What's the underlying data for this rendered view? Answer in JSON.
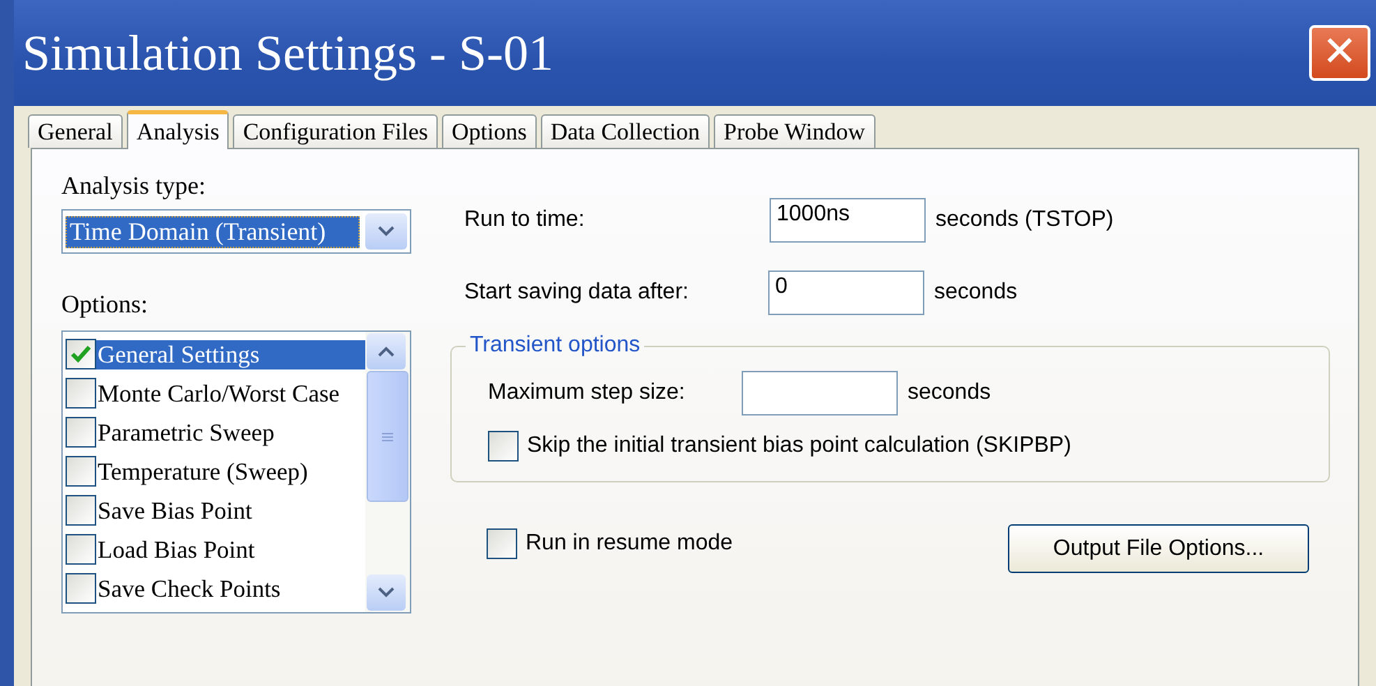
{
  "window": {
    "title": "Simulation Settings - S-01",
    "close": "✕"
  },
  "tabs": [
    {
      "label": "General",
      "selected": false
    },
    {
      "label": "Analysis",
      "selected": true
    },
    {
      "label": "Configuration Files",
      "selected": false
    },
    {
      "label": "Options",
      "selected": false
    },
    {
      "label": "Data Collection",
      "selected": false
    },
    {
      "label": "Probe Window",
      "selected": false
    }
  ],
  "analysis_type": {
    "label": "Analysis type:",
    "value": "Time Domain (Transient)"
  },
  "options": {
    "label": "Options:",
    "items": [
      {
        "label": "General Settings",
        "checked": true,
        "selected": true
      },
      {
        "label": "Monte Carlo/Worst Case",
        "checked": false,
        "selected": false
      },
      {
        "label": "Parametric Sweep",
        "checked": false,
        "selected": false
      },
      {
        "label": "Temperature (Sweep)",
        "checked": false,
        "selected": false
      },
      {
        "label": "Save Bias Point",
        "checked": false,
        "selected": false
      },
      {
        "label": "Load Bias Point",
        "checked": false,
        "selected": false
      },
      {
        "label": "Save Check Points",
        "checked": false,
        "selected": false
      }
    ]
  },
  "run_to_time": {
    "label": "Run to time:",
    "value": "1000ns",
    "unit": "seconds  (TSTOP)"
  },
  "start_saving": {
    "label": "Start saving data after:",
    "value": "0",
    "unit": "seconds"
  },
  "transient_options": {
    "legend": "Transient options",
    "max_step": {
      "label": "Maximum step size:",
      "unit": "seconds"
    },
    "skip_bias": {
      "label": "Skip the initial transient bias point calculation  (SKIPBP)",
      "checked": false
    }
  },
  "resume_mode": {
    "label": "Run in resume mode",
    "checked": false
  },
  "output_button": "Output File Options..."
}
